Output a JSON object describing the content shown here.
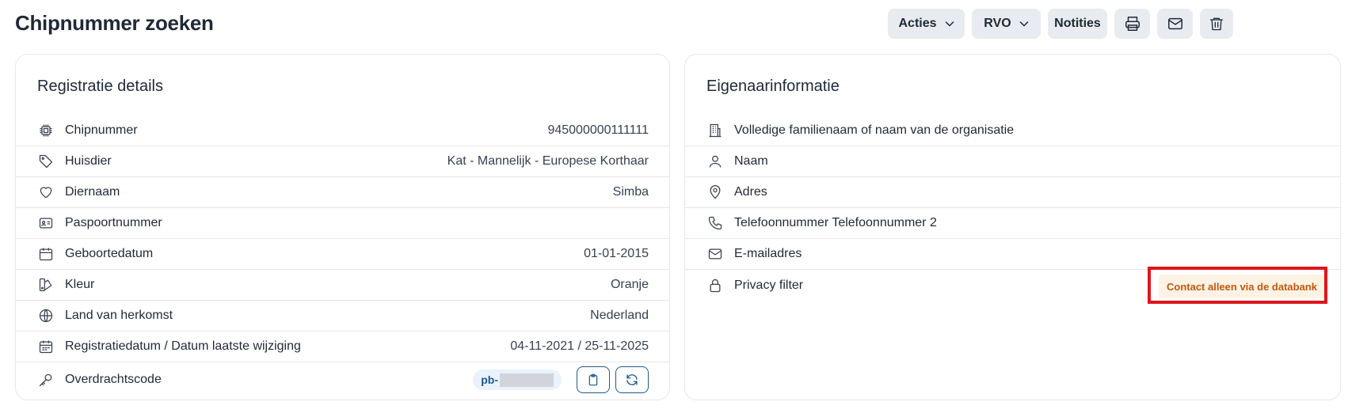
{
  "page": {
    "title": "Chipnummer zoeken"
  },
  "toolbar": {
    "acties_label": "Acties",
    "rvo_label": "RVO",
    "notities_label": "Notities"
  },
  "registratie": {
    "title": "Registratie details",
    "rows": [
      {
        "icon": "chip-icon",
        "label": "Chipnummer",
        "value": "945000000111111"
      },
      {
        "icon": "tag-icon",
        "label": "Huisdier",
        "value": "Kat - Mannelijk - Europese Korthaar"
      },
      {
        "icon": "heart-icon",
        "label": "Diernaam",
        "value": "Simba"
      },
      {
        "icon": "id-card-icon",
        "label": "Paspoortnummer",
        "value": ""
      },
      {
        "icon": "calendar-icon",
        "label": "Geboortedatum",
        "value": "01-01-2015"
      },
      {
        "icon": "swatch-icon",
        "label": "Kleur",
        "value": "Oranje"
      },
      {
        "icon": "globe-icon",
        "label": "Land van herkomst",
        "value": "Nederland"
      },
      {
        "icon": "calendar-days-icon",
        "label": "Registratiedatum / Datum laatste wijziging",
        "value": "04-11-2021 / 25-11-2025"
      },
      {
        "icon": "key-icon",
        "label": "Overdrachtscode",
        "value": "pb-"
      }
    ]
  },
  "eigenaar": {
    "title": "Eigenaarinformatie",
    "rows": [
      {
        "icon": "building-icon",
        "label": "Volledige familienaam of naam van de organisatie"
      },
      {
        "icon": "user-icon",
        "label": "Naam"
      },
      {
        "icon": "map-pin-icon",
        "label": "Adres"
      },
      {
        "icon": "phone-icon",
        "label": "Telefoonnummer Telefoonnummer 2"
      },
      {
        "icon": "mail-icon",
        "label": "E-mailadres"
      },
      {
        "icon": "lock-icon",
        "label": "Privacy filter",
        "badge": "Contact alleen via de databank"
      }
    ]
  },
  "colors": {
    "accent": "#1e5a8a",
    "badge_text": "#c2580e",
    "badge_bg": "#fdf3e4",
    "highlight": "#e0151b"
  }
}
